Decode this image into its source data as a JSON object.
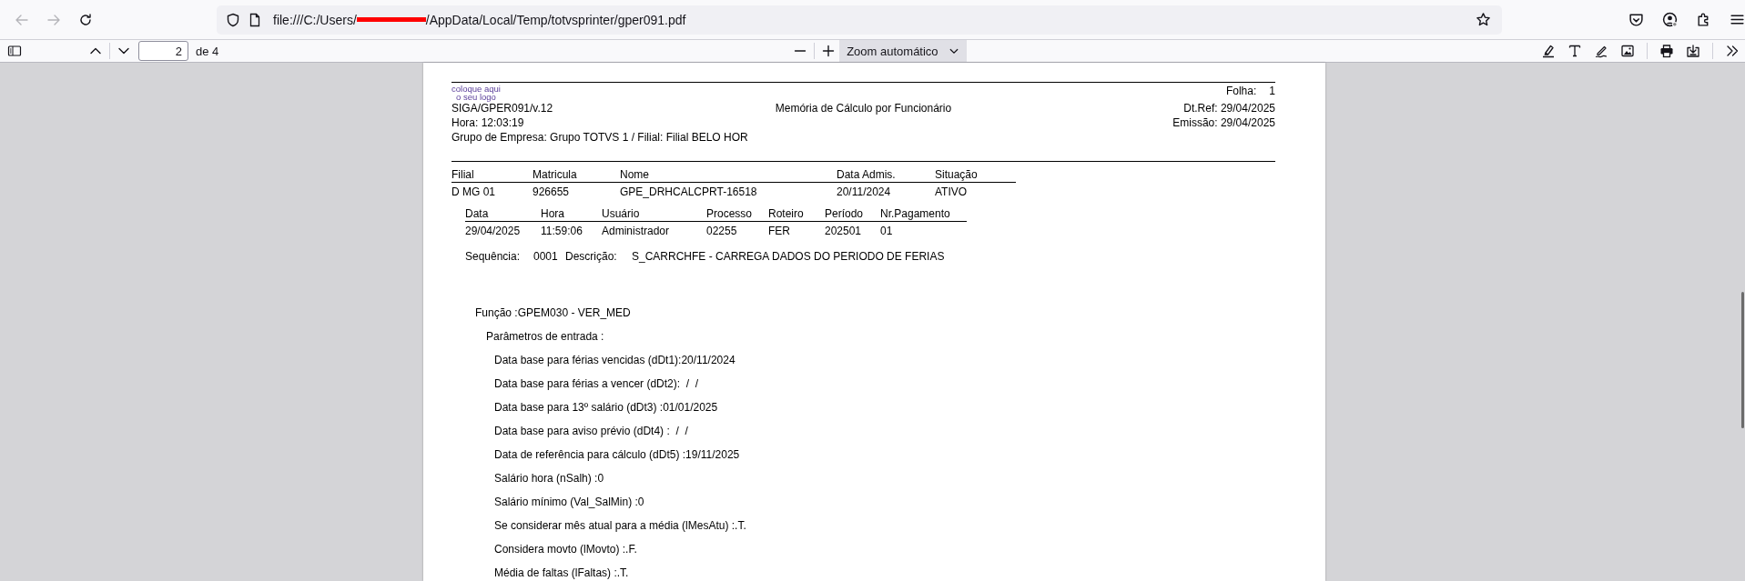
{
  "browser": {
    "nav_buttons": [
      {
        "kind": "back",
        "disabled": true
      },
      {
        "kind": "forward",
        "disabled": true
      },
      {
        "kind": "reload",
        "disabled": false
      }
    ],
    "url_start": "file:///C:/Users/",
    "url_end": "/AppData/Local/Temp/totvsprinter/gper091.pdf"
  },
  "pdf_toolbar": {
    "page_number": "2",
    "page_total": "de 4",
    "zoom": "Zoom automático"
  },
  "report": {
    "logo": [
      "coloque aqui",
      "o seu logo"
    ],
    "left_lines": [
      "SIGA/GPER091/v.12",
      "Hora: 12:03:19",
      "Grupo de Empresa: Grupo TOTVS 1 / Filial: Filial BELO HOR"
    ],
    "title": "Memória de Cálculo por Funcionário",
    "sheet_label": "Folha:",
    "sheet_number": "1",
    "right_lines": [
      "Dt.Ref: 29/04/2025",
      "Emissão: 29/04/2025"
    ],
    "employee_table": {
      "columns": [
        "Filial",
        "Matricula",
        "Nome",
        "Data Admis.",
        "Situação"
      ],
      "rows": [
        [
          "D MG 01",
          "926655",
          "GPE_DRHCALCPRT-16518",
          "20/11/2024",
          "ATIVO"
        ]
      ]
    },
    "history_table": {
      "columns": [
        "Data",
        "Hora",
        "Usuário",
        "Processo",
        "Roteiro",
        "Período",
        "Nr.Pagamento"
      ],
      "rows": [
        [
          "29/04/2025",
          "11:59:06",
          "Administrador",
          "02255",
          "FER",
          "202501",
          "01"
        ]
      ]
    },
    "sequence": {
      "label": "Sequência:",
      "value": "0001",
      "description_label": "Descrição:",
      "description": "S_CARRCHFE - CARREGA DADOS DO PERIODO DE FERIAS"
    },
    "function_line": "Função :GPEM030 - VER_MED",
    "params_header": "Parâmetros de entrada :",
    "params": [
      "Data base para férias vencidas (dDt1):20/11/2024",
      "Data base para férias a vencer (dDt2):  /  /",
      "Data base para 13º salário (dDt3) :01/01/2025",
      "Data base para aviso prévio (dDt4) :  /  /",
      "Data de referência para cálculo (dDt5) :19/11/2025",
      "Salário hora (nSalh) :0",
      "Salário mínimo (Val_SalMin) :0",
      "Se considerar mês atual para a média (lMesAtu) :.T.",
      "Considera movto (lMovto) :.F.",
      "Média de faltas (lFaltas) :.T."
    ]
  }
}
